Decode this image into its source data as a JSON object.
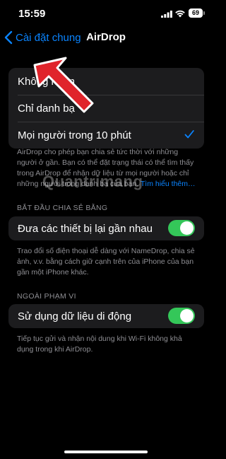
{
  "status_bar": {
    "time": "15:59",
    "battery": "69"
  },
  "nav": {
    "back_label": "Cài đặt chung",
    "title": "AirDrop"
  },
  "receiving": {
    "options": [
      "Không nhận",
      "Chỉ danh bạ",
      "Mọi người trong 10 phút"
    ],
    "selected_index": 2,
    "note": "AirDrop cho phép bạn chia sẻ tức thời với những người ở gần. Bạn có thể đặt trạng thái có thể tìm thấy trong AirDrop để nhận dữ liệu từ mọi người hoặc chỉ những người trong danh bạ của bạn.",
    "learn_more": "Tìm hiểu thêm…"
  },
  "start_sharing": {
    "header": "BẮT ĐẦU CHIA SẺ BẰNG",
    "toggle_label": "Đưa các thiết bị lại gần nhau",
    "toggle_on": true,
    "note": "Trao đổi số điện thoại dễ dàng với NameDrop, chia sẻ ảnh, v.v. bằng cách giữ cạnh trên của iPhone của bạn gần một iPhone khác."
  },
  "out_of_range": {
    "header": "NGOÀI PHẠM VI",
    "toggle_label": "Sử dụng dữ liệu di động",
    "toggle_on": true,
    "note": "Tiếp tục gửi và nhận nội dung khi Wi-Fi không khả dụng trong khi AirDrop."
  },
  "watermark": "Quantrimang",
  "colors": {
    "accent": "#0a84ff",
    "toggle_on": "#34c759",
    "arrow": "#e0242b"
  }
}
